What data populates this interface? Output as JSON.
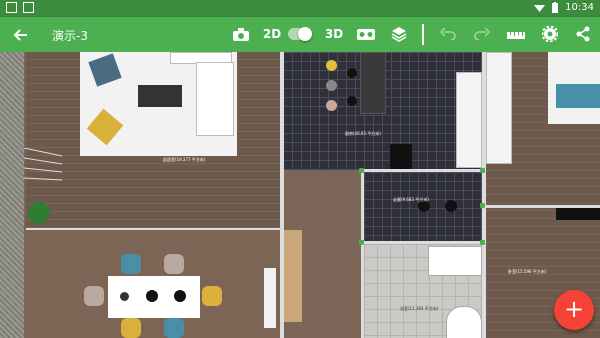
{
  "status_bar": {
    "time": "10:34"
  },
  "toolbar": {
    "title": "演示-3",
    "mode_2d_label": "2D",
    "mode_3d_label": "3D"
  },
  "rooms": {
    "living_room": "起居室(19.377 平方米)",
    "kitchen": "厨房(40.65 平方米)",
    "hall": "走廊(9.683 平方米)",
    "bathroom": "浴室(11.364 平方米)",
    "bedroom": "卧室(15.596 平方米)"
  },
  "colors": {
    "accent": "#4caf50",
    "fab": "#f44336"
  },
  "icons": [
    "back-arrow-icon",
    "camera-icon",
    "vr-headset-icon",
    "layers-icon",
    "undo-icon",
    "redo-icon",
    "ruler-icon",
    "gear-icon",
    "share-icon",
    "add-icon"
  ]
}
